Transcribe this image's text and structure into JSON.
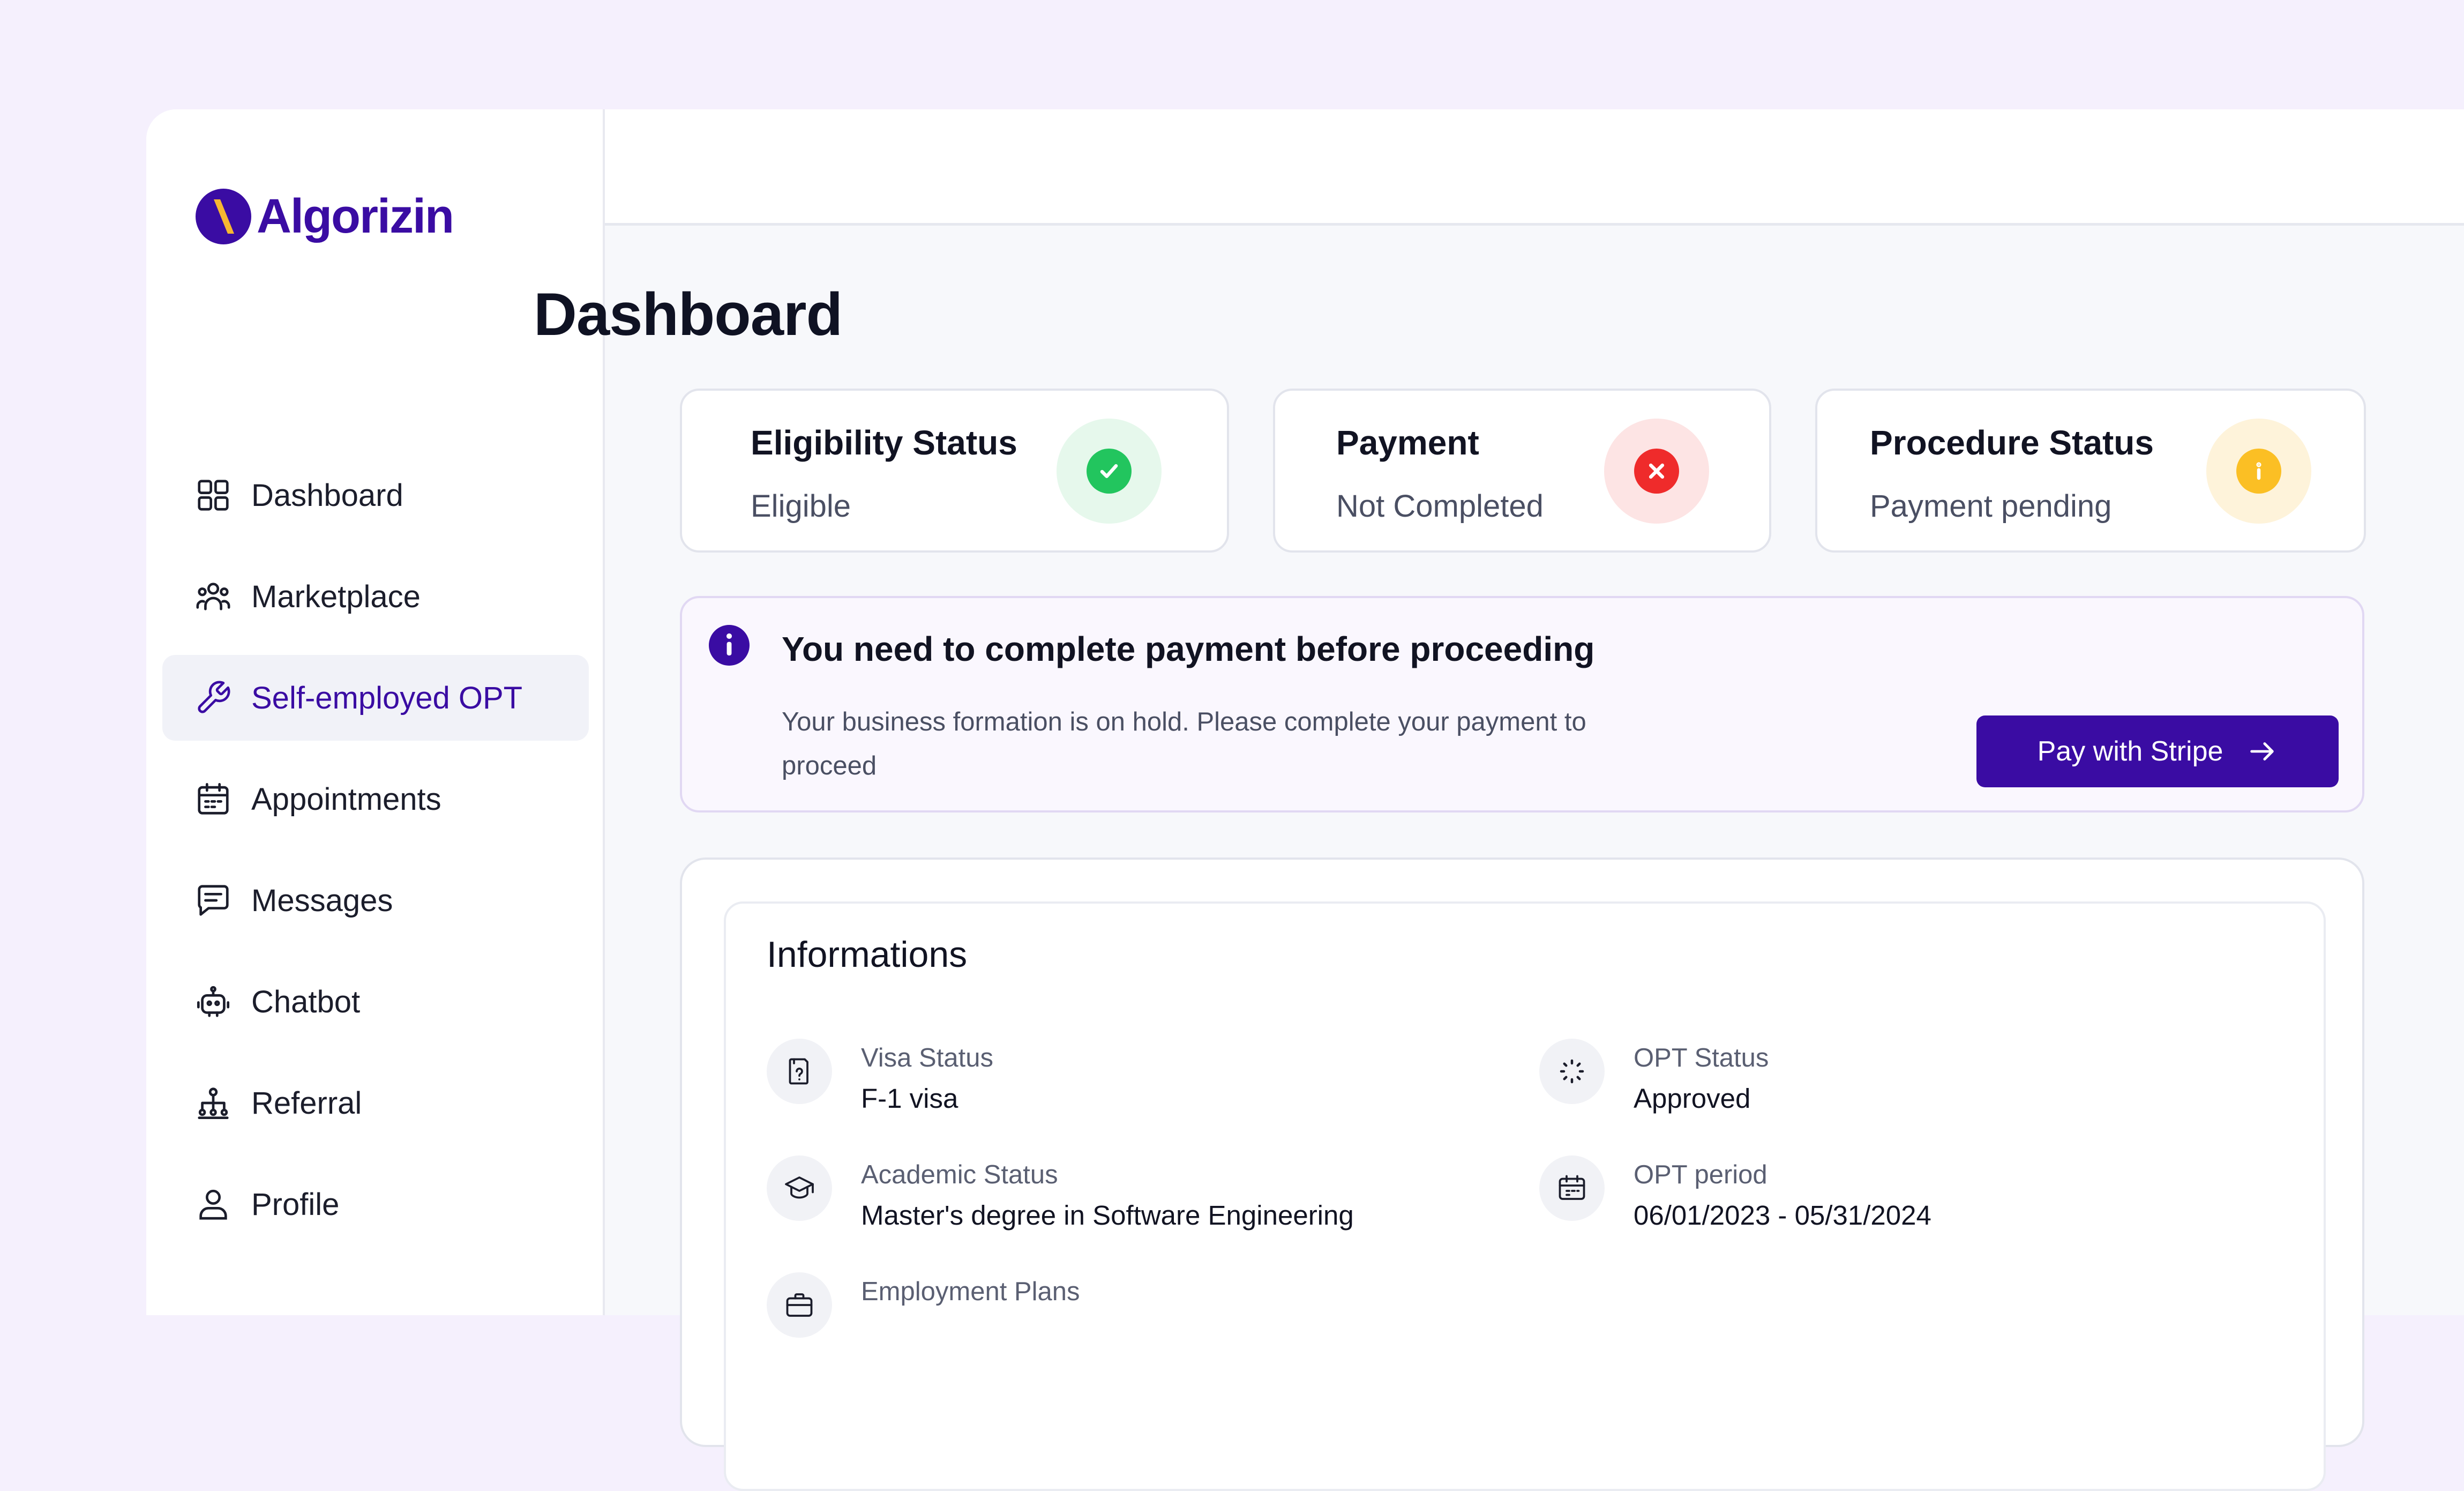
{
  "brand": {
    "name": "Algorizin",
    "color": "#3a0ca3",
    "accent": "#f7b731"
  },
  "sidebar": {
    "items": [
      {
        "label": "Dashboard",
        "icon": "grid-icon",
        "active": false
      },
      {
        "label": "Marketplace",
        "icon": "users-icon",
        "active": false
      },
      {
        "label": "Self-employed OPT",
        "icon": "wrench-icon",
        "active": true
      },
      {
        "label": "Appointments",
        "icon": "calendar-icon",
        "active": false
      },
      {
        "label": "Messages",
        "icon": "message-icon",
        "active": false
      },
      {
        "label": "Chatbot",
        "icon": "robot-icon",
        "active": false
      },
      {
        "label": "Referral",
        "icon": "network-icon",
        "active": false
      },
      {
        "label": "Profile",
        "icon": "user-icon",
        "active": false
      }
    ]
  },
  "header": {
    "avatar": "user-avatar"
  },
  "main": {
    "title": "Dashboard",
    "status_cards": [
      {
        "title": "Eligibility Status",
        "value": "Eligible",
        "icon": "check-icon",
        "color": "#22c55e",
        "bg": "#e6f8ec"
      },
      {
        "title": "Payment",
        "value": "Not Completed",
        "icon": "close-icon",
        "color": "#ef2b2b",
        "bg": "#fde4e4"
      },
      {
        "title": "Procedure Status",
        "value": "Payment pending",
        "icon": "info-icon",
        "color": "#fbbf24",
        "bg": "#fef3da"
      }
    ],
    "alert": {
      "icon": "info-icon",
      "title": "You need to complete payment before proceeding",
      "body": "Your business formation is on hold. Please complete your payment to proceed",
      "button_label": "Pay with Stripe"
    },
    "info": {
      "title": "Informations",
      "items": [
        {
          "label": "Visa Status",
          "value": "F-1 visa",
          "icon": "passport-icon"
        },
        {
          "label": "OPT Status",
          "value": "Approved",
          "icon": "loading-icon"
        },
        {
          "label": "Academic Status",
          "value": "Master's degree in Software Engineering",
          "icon": "graduation-cap-icon"
        },
        {
          "label": "OPT period",
          "value": "06/01/2023 - 05/31/2024",
          "icon": "calendar-icon"
        },
        {
          "label": "Employment Plans",
          "value": "",
          "icon": "briefcase-icon"
        }
      ]
    }
  }
}
